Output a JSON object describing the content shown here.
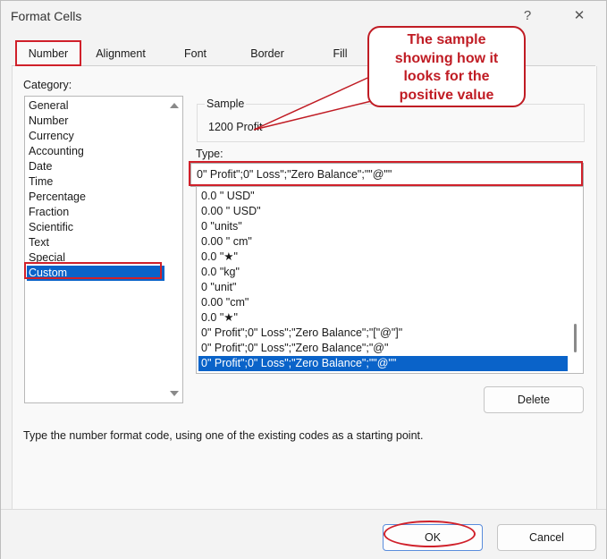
{
  "window": {
    "title": "Format Cells",
    "help_glyph": "?",
    "close_glyph": "✕"
  },
  "tabs": [
    {
      "label": "Number",
      "active": true
    },
    {
      "label": "Alignment"
    },
    {
      "label": "Font"
    },
    {
      "label": "Border"
    },
    {
      "label": "Fill"
    }
  ],
  "category": {
    "label": "Category:",
    "items": [
      "General",
      "Number",
      "Currency",
      "Accounting",
      "Date",
      "Time",
      "Percentage",
      "Fraction",
      "Scientific",
      "Text",
      "Special",
      "Custom"
    ],
    "selected": "Custom"
  },
  "sample": {
    "label": "Sample",
    "value": "1200 Profit"
  },
  "type": {
    "label": "Type:",
    "value": "0\" Profit\";0\" Loss\";\"Zero Balance\";\"\"@\"\"",
    "items": [
      "0.0 \" USD\"",
      "0.00 \" USD\"",
      "0 \"units\"",
      "0.00 \" cm\"",
      "0.0 \"★\"",
      "0.0 \"kg\"",
      "0 \"unit\"",
      "0.00 \"cm\"",
      "0.0 \"★\"",
      "0\" Profit\";0\" Loss\";\"Zero Balance\";\"[\"@\"]\"",
      "0\" Profit\";0\" Loss\";\"Zero Balance\";\"@\"",
      "0\" Profit\";0\" Loss\";\"Zero Balance\";\"\"@\"\""
    ],
    "selected_index": 11
  },
  "buttons": {
    "delete": "Delete",
    "ok": "OK",
    "cancel": "Cancel"
  },
  "hint": "Type the number format code, using one of the existing codes as a starting point.",
  "callout": {
    "lines": [
      "The sample",
      "showing how it",
      "looks for the",
      "positive value"
    ]
  },
  "colors": {
    "annotation_red": "#d0202a",
    "selection_blue": "#0a63c9"
  }
}
